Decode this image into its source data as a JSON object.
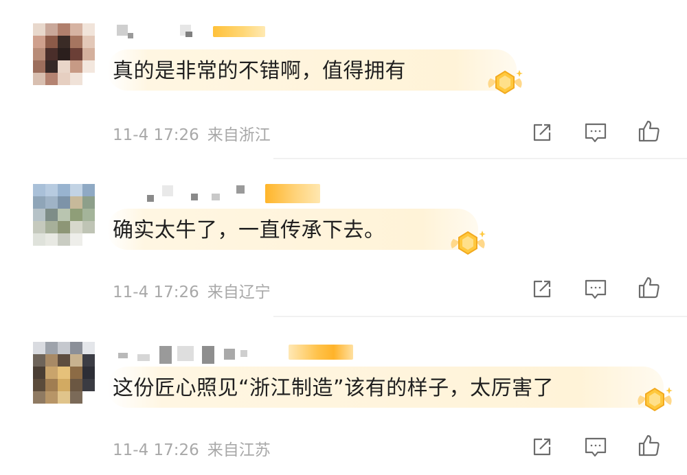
{
  "comments": [
    {
      "text": "真的是非常的不错啊，值得拥有",
      "time": "11-4 17:26",
      "location": "来自浙江",
      "avatar_colors": [
        "#e8d8cc",
        "#c9a89a",
        "#b07f6c",
        "#d6b3a2",
        "#f1e4da",
        "#cfa08d",
        "#8c5a48",
        "#3a2b26",
        "#a67560",
        "#e3c8b8",
        "#b88c78",
        "#4a2e2a",
        "#2b1f1d",
        "#6b3f36",
        "#d4b09d",
        "#9c6e5c",
        "#352826",
        "#e9d6c9",
        "#c79a85",
        "#f3e7de",
        "#d8bfb0",
        "#b48371",
        "#e6cfc1",
        "#f0e2d8",
        "#ffffff"
      ]
    },
    {
      "text": "确实太牛了，一直传承下去。",
      "time": "11-4 17:26",
      "location": "来自辽宁",
      "avatar_colors": [
        "#a9c0d8",
        "#b7cbe0",
        "#98b3cf",
        "#c2d3e4",
        "#8fa9c4",
        "#8fa5b8",
        "#9fb3c6",
        "#7d93a8",
        "#c7b99a",
        "#8d9f8a",
        "#b6c2c7",
        "#7e8d88",
        "#b9c5b0",
        "#8f9e78",
        "#a4b49a",
        "#c5c9bd",
        "#a7b09a",
        "#8d9676",
        "#d7d8cc",
        "#bfc4b5",
        "#dfe2db",
        "#e8e9e3",
        "#c9ccc2",
        "#eeeeea",
        "#ffffff"
      ]
    },
    {
      "text": "这份匠心照见“浙江制造”该有的样子，太厉害了",
      "time": "11-4 17:26",
      "location": "来自江苏",
      "avatar_colors": [
        "#d9dbe0",
        "#9ea3ab",
        "#c5c8ce",
        "#8b8f98",
        "#e4e6ea",
        "#6e645a",
        "#a88a66",
        "#5d4d3f",
        "#c8b28f",
        "#3c3d45",
        "#4a3e34",
        "#c9a46c",
        "#e6c17a",
        "#8c6b45",
        "#2d2e36",
        "#5b4b3b",
        "#a07d52",
        "#d2aa62",
        "#6b5742",
        "#3a3b42",
        "#8f7a62",
        "#b79567",
        "#e0c48b",
        "#7b6a58",
        "#ffffff"
      ]
    }
  ],
  "actions": {
    "repost_label": "repost-icon",
    "comment_label": "comment-icon",
    "like_label": "like-icon"
  },
  "colors": {
    "text": "#1f1f1f",
    "meta": "#a8a8a8",
    "icon": "#6b6b6b",
    "bubble": "#fff4dc",
    "medal": "#ffc83d"
  }
}
